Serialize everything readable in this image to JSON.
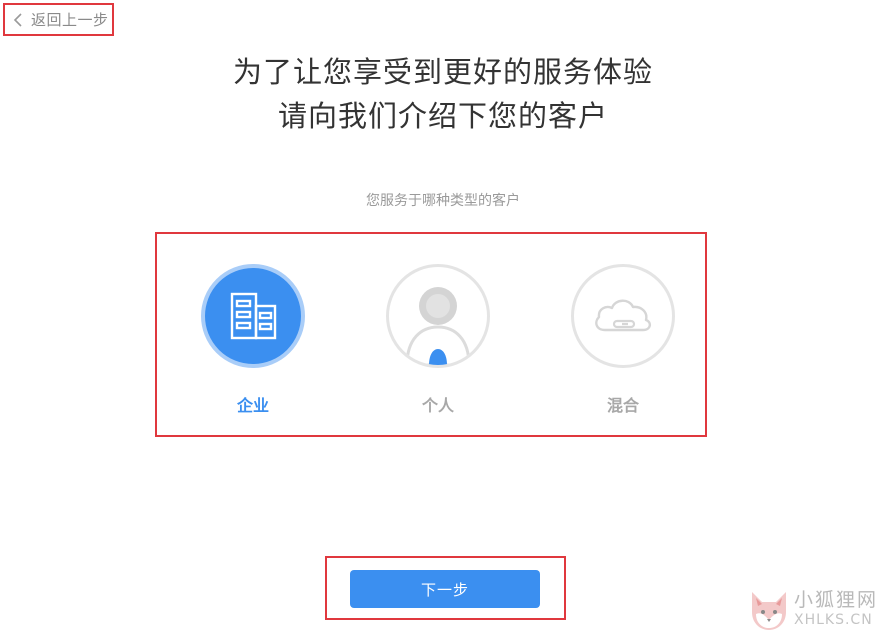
{
  "nav": {
    "back_label": "返回上一步"
  },
  "header": {
    "title_line1": "为了让您享受到更好的服务体验",
    "title_line2": "请向我们介绍下您的客户"
  },
  "question": {
    "text": "您服务于哪种类型的客户"
  },
  "options": [
    {
      "label": "企业",
      "icon": "building-icon",
      "selected": true
    },
    {
      "label": "个人",
      "icon": "person-icon",
      "selected": false
    },
    {
      "label": "混合",
      "icon": "cloud-link-icon",
      "selected": false
    }
  ],
  "actions": {
    "next_label": "下一步"
  },
  "watermark": {
    "brand_cn": "小狐狸网",
    "brand_en": "XHLKS.CN"
  },
  "colors": {
    "accent": "#3b8ff0",
    "highlight_border": "#e0383e",
    "muted_text": "#a8a8a8"
  }
}
